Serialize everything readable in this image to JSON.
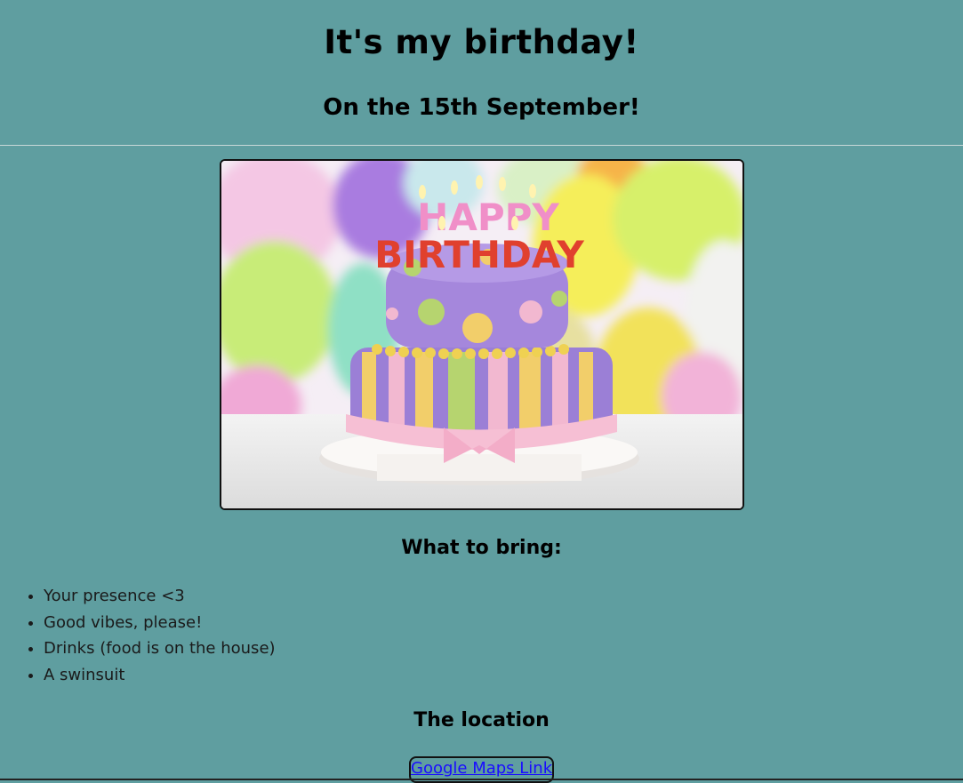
{
  "page": {
    "background_color": "#5f9ea0",
    "title": "It's my birthday!",
    "subtitle": "On the 15th September!"
  },
  "image": {
    "name": "birthday-cake-image",
    "topper_line1": "HAPPY",
    "topper_line2": "BIRTHDAY"
  },
  "bring": {
    "heading": "What to bring:",
    "items": [
      "Your presence <3",
      "Good vibes, please!",
      "Drinks (food is on the house)",
      "A swinsuit"
    ]
  },
  "location": {
    "heading": "The location",
    "link_label": "Google Maps Link"
  }
}
